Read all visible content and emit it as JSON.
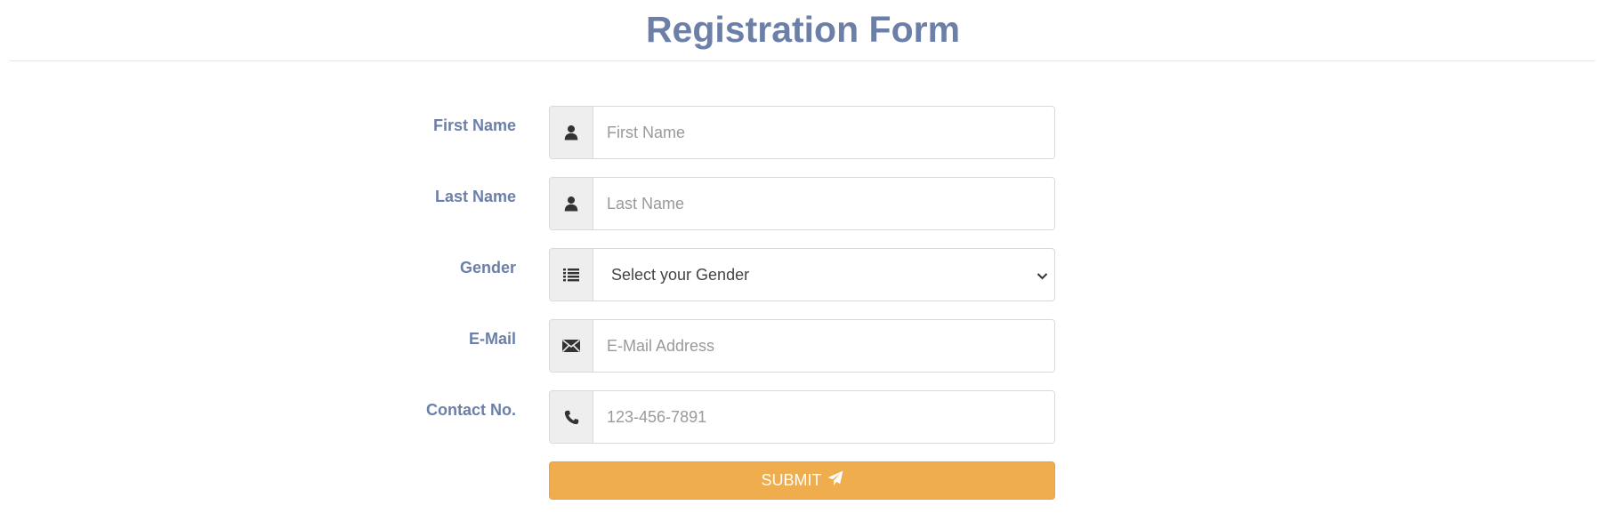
{
  "form": {
    "title": "Registration Form",
    "fields": [
      {
        "label": "First Name",
        "icon": "user-icon",
        "placeholder": "First Name"
      },
      {
        "label": "Last Name",
        "icon": "user-icon",
        "placeholder": "Last Name"
      },
      {
        "label": "Gender",
        "icon": "list-icon",
        "selected": "Select your Gender"
      },
      {
        "label": "E-Mail",
        "icon": "envelope-icon",
        "placeholder": "E-Mail Address"
      },
      {
        "label": "Contact No.",
        "icon": "phone-icon",
        "placeholder": "123-456-7891"
      }
    ],
    "submit_label": "SUBMIT",
    "submit_icon": "send-icon"
  },
  "colors": {
    "title": "#6b7fa8",
    "label": "#6b7fa8",
    "submit_bg": "#f0ad4e",
    "addon_bg": "#eeeeee"
  }
}
